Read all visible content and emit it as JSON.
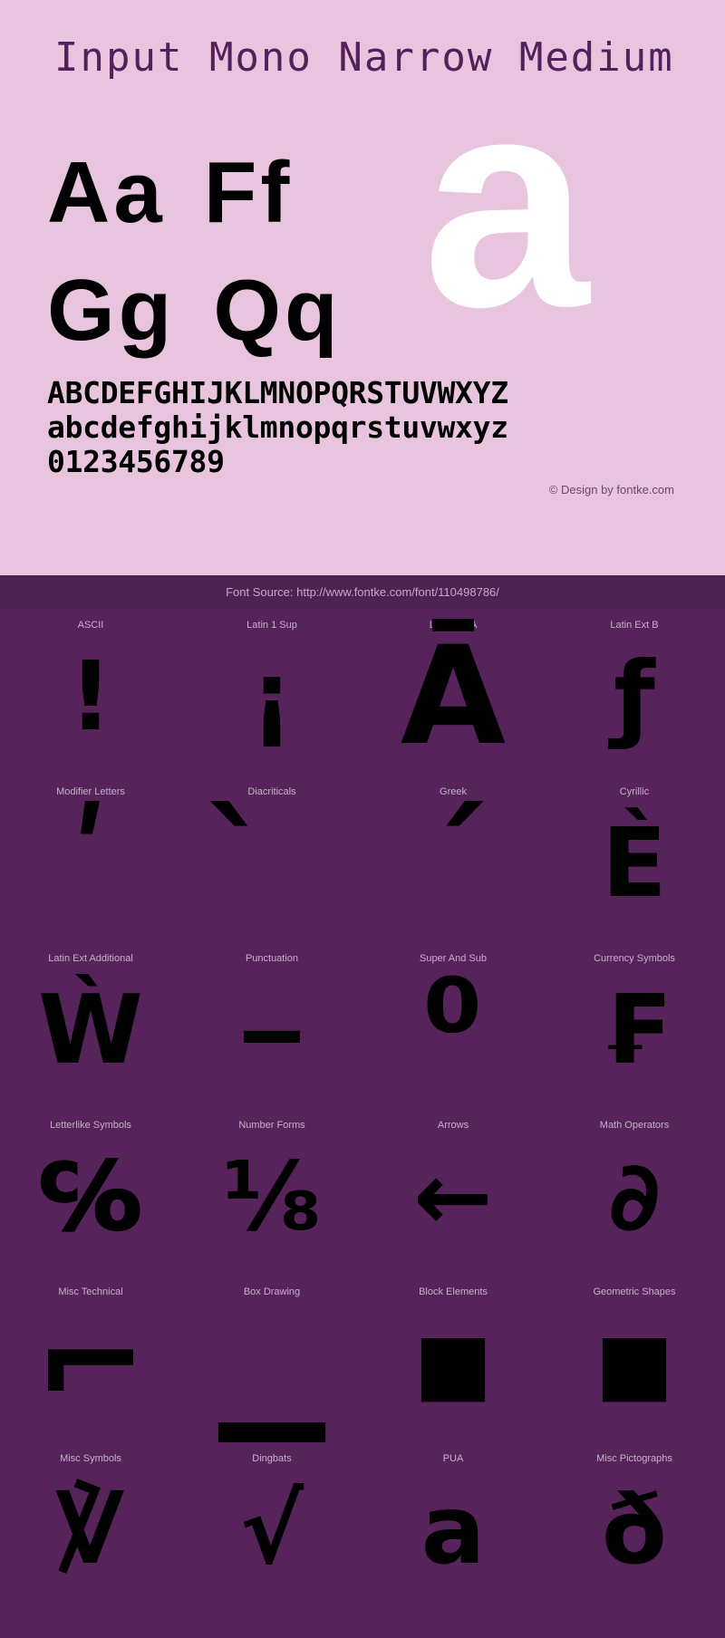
{
  "colors": {
    "specimen_bg": "#e8c4de",
    "title": "#52205a",
    "glyph": "#000000",
    "watermark": "#ffffff",
    "blocks_bg": "#56245a",
    "source_bar_bg": "#4e2352",
    "label": "#c9aecb"
  },
  "specimen": {
    "title": "Input Mono Narrow Medium",
    "watermark_glyph": "a",
    "big_rows": [
      {
        "left": "Aa",
        "right": "Ff"
      },
      {
        "left": "Gg",
        "right": "Qq"
      }
    ],
    "charset_lines": [
      "ABCDEFGHIJKLMNOPQRSTUVWXYZ",
      "abcdefghijklmnopqrstuvwxyz",
      "0123456789"
    ],
    "credit": "© Design by fontke.com"
  },
  "source_bar": {
    "text": "Font Source: http://www.fontke.com/font/110498786/"
  },
  "blocks": {
    "rows": [
      [
        {
          "label": "ASCII",
          "glyph": "!"
        },
        {
          "label": "Latin 1 Sup",
          "glyph": "¡"
        },
        {
          "label": "Latin Ext A",
          "glyph": "Ā"
        },
        {
          "label": "Latin Ext B",
          "glyph": "ƒ"
        }
      ],
      [
        {
          "label": "Modifier Letters",
          "glyph": "ʹ"
        },
        {
          "label": "Diacriticals",
          "glyph": "̀"
        },
        {
          "label": "Greek",
          "glyph": "΄"
        },
        {
          "label": "Cyrillic",
          "glyph": "Ѐ"
        }
      ],
      [
        {
          "label": "Latin Ext Additional",
          "glyph": "Ẁ"
        },
        {
          "label": "Punctuation",
          "glyph": "‒"
        },
        {
          "label": "Super And Sub",
          "glyph": "⁰"
        },
        {
          "label": "Currency Symbols",
          "glyph": "₣"
        }
      ],
      [
        {
          "label": "Letterlike Symbols",
          "glyph": "℅"
        },
        {
          "label": "Number Forms",
          "glyph": "⅛"
        },
        {
          "label": "Arrows",
          "glyph": "←"
        },
        {
          "label": "Math Operators",
          "glyph": "∂"
        }
      ],
      [
        {
          "label": "Misc Technical",
          "glyph": "⌐"
        },
        {
          "label": "Box Drawing",
          "glyph": "▁"
        },
        {
          "label": "Block Elements",
          "glyph": "■"
        },
        {
          "label": "Geometric Shapes",
          "glyph": "■"
        }
      ],
      [
        {
          "label": "Misc Symbols",
          "glyph": "℣"
        },
        {
          "label": "Dingbats",
          "glyph": "√"
        },
        {
          "label": "PUA",
          "glyph": "a"
        },
        {
          "label": "Misc Pictographs",
          "glyph": "ð"
        }
      ]
    ]
  }
}
